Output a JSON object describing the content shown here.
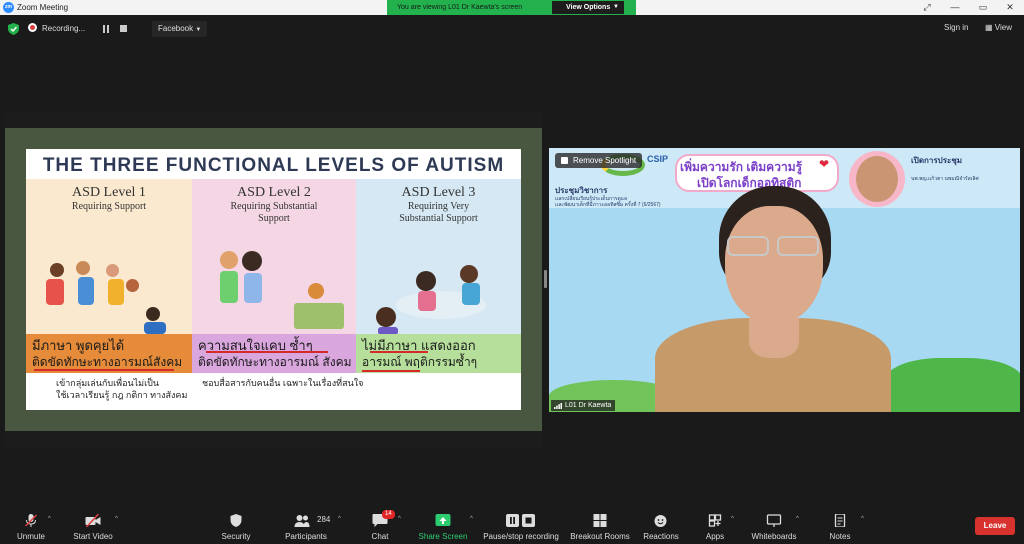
{
  "window": {
    "title": "Zoom Meeting",
    "logo_text": "zm",
    "controls": [
      "—",
      "▭",
      "✕"
    ],
    "fullscreen_icon": "⤢"
  },
  "banner": {
    "message": "You are viewing L01 Dr Kaewta's screen",
    "options_label": "View Options"
  },
  "topbar": {
    "recording_label": "Recording...",
    "facebook_label": "Facebook",
    "sign_in": "Sign in",
    "view_label": "View"
  },
  "slide": {
    "title": "THE THREE FUNCTIONAL LEVELS OF AUTISM",
    "levels": [
      {
        "heading": "ASD Level 1",
        "sub": "Requiring Support",
        "band_line1": "มีภาษา พูดคุยได้",
        "band_line2": "ติดขัดทักษะทางอารมณ์สังคม",
        "desc_line1": "เข้ากลุ่มเล่นกับเพื่อนไม่เป็น",
        "desc_line2": "ใช้เวลาเรียนรู้ กฎ กติกา ทางสังคม"
      },
      {
        "heading": "ASD Level 2",
        "sub_line1": "Requiring Substantial",
        "sub_line2": "Support",
        "band_line1": "ความสนใจแคบ ซ้ำๆ",
        "band_line2": "ติดขัดทักษะทางอารมณ์ สังคม",
        "desc_line1": "ชอบสื่อสารกับคนอื่น เฉพาะในเรื่องที่สนใจ"
      },
      {
        "heading": "ASD Level 3",
        "sub_line1": "Requiring Very",
        "sub_line2": "Substantial Support",
        "band_line1": "ไม่มีภาษา แสดงออก",
        "band_line2": "อารมณ์ พฤติกรรมซ้ำๆ"
      }
    ]
  },
  "video": {
    "remove_spotlight": "Remove Spotlight",
    "participant_name": "L01 Dr Kaewta",
    "csip": "CSIP",
    "headline_line1": "เพิ่มความรัก เติมความรู้",
    "headline_line2": "เปิดโลกเด็กออทิสติก",
    "left_title": "ประชุมวิชาการ",
    "left_line1": "แลกเปลี่ยนเรียนรู้ประเด็นการดูแล",
    "left_line2": "และพัฒนาเด็กที่มีภาวะออทิสซึม ครั้งที่ 7 (6/2567)",
    "right_title": "เปิดการประชุม",
    "right_line1": "นพ.พญ.แก้วตา นพมณีจำรัสเลิศ",
    "colors": {
      "sky": "#a8d9f2",
      "grass": "#4fb749"
    }
  },
  "toolbar": {
    "mute": "Unmute",
    "video": "Start Video",
    "security": "Security",
    "participants": "Participants",
    "participants_count": "284",
    "chat": "Chat",
    "chat_badge": "14",
    "share": "Share Screen",
    "record": "Pause/stop recording",
    "breakout": "Breakout Rooms",
    "reactions": "Reactions",
    "apps": "Apps",
    "whiteboards": "Whiteboards",
    "notes": "Notes",
    "leave": "Leave"
  }
}
